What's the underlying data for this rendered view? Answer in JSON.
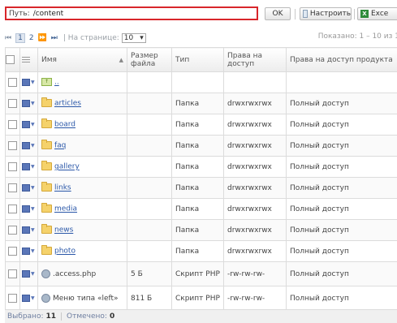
{
  "path": {
    "label": "Путь:",
    "value": "/content"
  },
  "toolbar": {
    "ok_label": "OK",
    "settings_label": "Настроить",
    "excel_label": "Exce"
  },
  "pager": {
    "first": "⏮",
    "prev": "⏪",
    "page1": "1",
    "page2": "2",
    "next": "⏩",
    "last": "⏭",
    "per_page_label": "| На странице:",
    "per_page_value": "10",
    "shown": "Показано: 1 – 10 из 1"
  },
  "columns": {
    "name": "Имя",
    "size": "Размер файла",
    "type": "Тип",
    "perm": "Права на доступ",
    "perm_product": "Права на доступ продукта"
  },
  "rows": [
    {
      "name": "..",
      "size": "",
      "type": "",
      "perm": "",
      "perm_product": ""
    },
    {
      "name": "articles",
      "size": "",
      "type": "Папка",
      "perm": "drwxrwxrwx",
      "perm_product": "Полный доступ"
    },
    {
      "name": "board",
      "size": "",
      "type": "Папка",
      "perm": "drwxrwxrwx",
      "perm_product": "Полный доступ"
    },
    {
      "name": "faq",
      "size": "",
      "type": "Папка",
      "perm": "drwxrwxrwx",
      "perm_product": "Полный доступ"
    },
    {
      "name": "gallery",
      "size": "",
      "type": "Папка",
      "perm": "drwxrwxrwx",
      "perm_product": "Полный доступ"
    },
    {
      "name": "links",
      "size": "",
      "type": "Папка",
      "perm": "drwxrwxrwx",
      "perm_product": "Полный доступ"
    },
    {
      "name": "media",
      "size": "",
      "type": "Папка",
      "perm": "drwxrwxrwx",
      "perm_product": "Полный доступ"
    },
    {
      "name": "news",
      "size": "",
      "type": "Папка",
      "perm": "drwxrwxrwx",
      "perm_product": "Полный доступ"
    },
    {
      "name": "photo",
      "size": "",
      "type": "Папка",
      "perm": "drwxrwxrwx",
      "perm_product": "Полный доступ"
    },
    {
      "name": ".access.php",
      "size": "5 Б",
      "type": "Скрипт PHP",
      "perm": "-rw-rw-rw-",
      "perm_product": "Полный доступ"
    },
    {
      "name": "Меню типа «left»",
      "size": "811 Б",
      "type": "Скрипт PHP",
      "perm": "-rw-rw-rw-",
      "perm_product": "Полный доступ"
    }
  ],
  "footer": {
    "selected_label": "Выбрано:",
    "selected_value": "11",
    "checked_label": "Отмечено:",
    "checked_value": "0"
  },
  "colors": {
    "highlight_border": "#d8262b",
    "link": "#2a57a8",
    "folder": "#f5d26b"
  }
}
